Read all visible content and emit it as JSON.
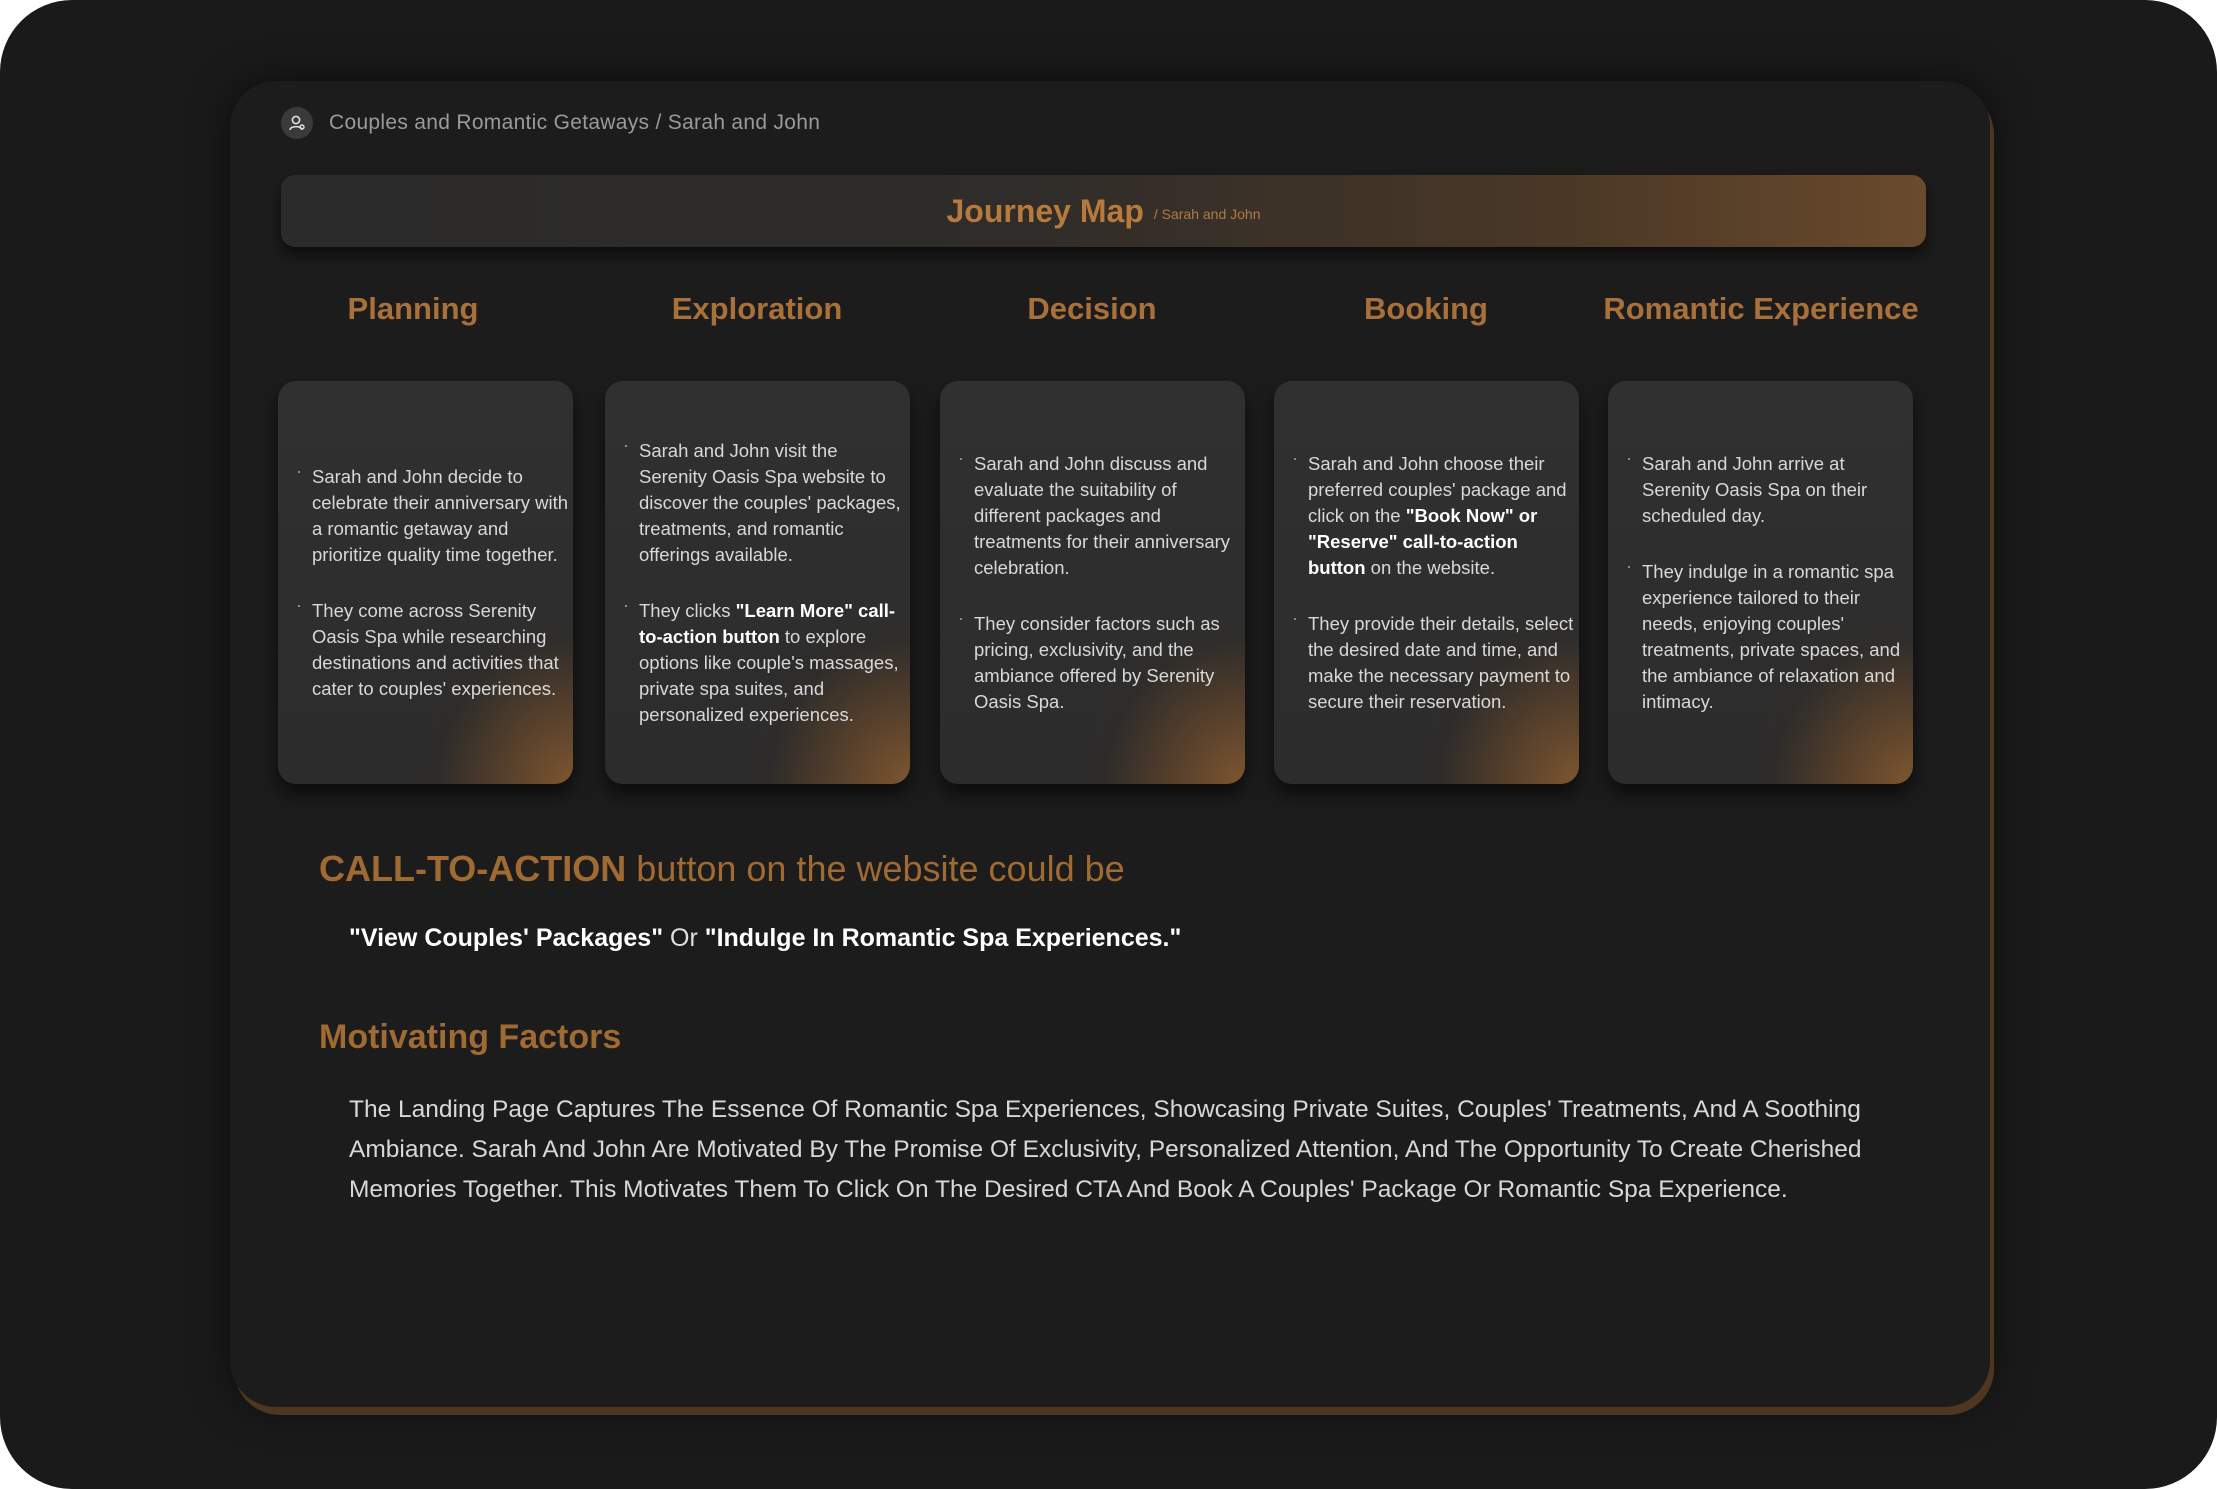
{
  "breadcrumb": {
    "text": "Couples and Romantic Getaways / Sarah and John",
    "icon": "user-icon"
  },
  "header": {
    "title": "Journey Map",
    "subtitle": "/ Sarah and John"
  },
  "stages": [
    {
      "title": "Planning",
      "bullets": [
        {
          "pre": "Sarah and John decide to celebrate their anniversary with a romantic getaway and prioritize quality time together.",
          "bold": "",
          "post": ""
        },
        {
          "pre": "They come across Serenity Oasis Spa while researching destinations and activities that cater to couples' experiences.",
          "bold": "",
          "post": ""
        }
      ]
    },
    {
      "title": "Exploration",
      "bullets": [
        {
          "pre": "Sarah and John visit the Serenity Oasis Spa website to discover the couples' packages, treatments, and romantic offerings available.",
          "bold": "",
          "post": ""
        },
        {
          "pre": "They clicks ",
          "bold": "\"Learn More\" call-to-action button",
          "post": " to explore options like couple's massages, private spa suites, and personalized experiences."
        }
      ]
    },
    {
      "title": "Decision",
      "bullets": [
        {
          "pre": "Sarah and John discuss and evaluate the suitability of different packages and treatments for their anniversary celebration.",
          "bold": "",
          "post": ""
        },
        {
          "pre": "They consider factors such as pricing, exclusivity, and the ambiance offered by Serenity Oasis Spa.",
          "bold": "",
          "post": ""
        }
      ]
    },
    {
      "title": "Booking",
      "bullets": [
        {
          "pre": "Sarah and John choose their preferred couples' package and click on the ",
          "bold": "\"Book Now\" or \"Reserve\" call-to-action button",
          "post": " on the website."
        },
        {
          "pre": "They provide their details, select the desired date and time, and make the necessary payment to secure their reservation.",
          "bold": "",
          "post": ""
        }
      ]
    },
    {
      "title": "Romantic Experience",
      "bullets": [
        {
          "pre": "Sarah and John arrive at Serenity Oasis Spa on their scheduled day.",
          "bold": "",
          "post": ""
        },
        {
          "pre": "They indulge in a romantic spa experience tailored to their needs, enjoying couples' treatments, private spaces, and the ambiance of relaxation and intimacy.",
          "bold": "",
          "post": ""
        }
      ]
    }
  ],
  "cta": {
    "heading_bold": "CALL-TO-ACTION",
    "heading_rest": " button on the website could be",
    "option1": "\"View Couples' Packages\"",
    "or": " Or ",
    "option2": "\"Indulge In Romantic Spa Experiences.\""
  },
  "motivating": {
    "heading": "Motivating Factors",
    "text": "The Landing Page Captures The Essence Of Romantic Spa Experiences, Showcasing Private Suites, Couples' Treatments, And A Soothing Ambiance. Sarah And John Are Motivated By The Promise Of Exclusivity, Personalized Attention, And The Opportunity To Create Cherished Memories Together. This Motivates Them To Click On The Desired CTA And Book A Couples' Package Or Romantic Spa Experience."
  },
  "colors": {
    "accent": "#a9703a",
    "background": "#1a1a1a",
    "card": "#2c2c2c"
  }
}
